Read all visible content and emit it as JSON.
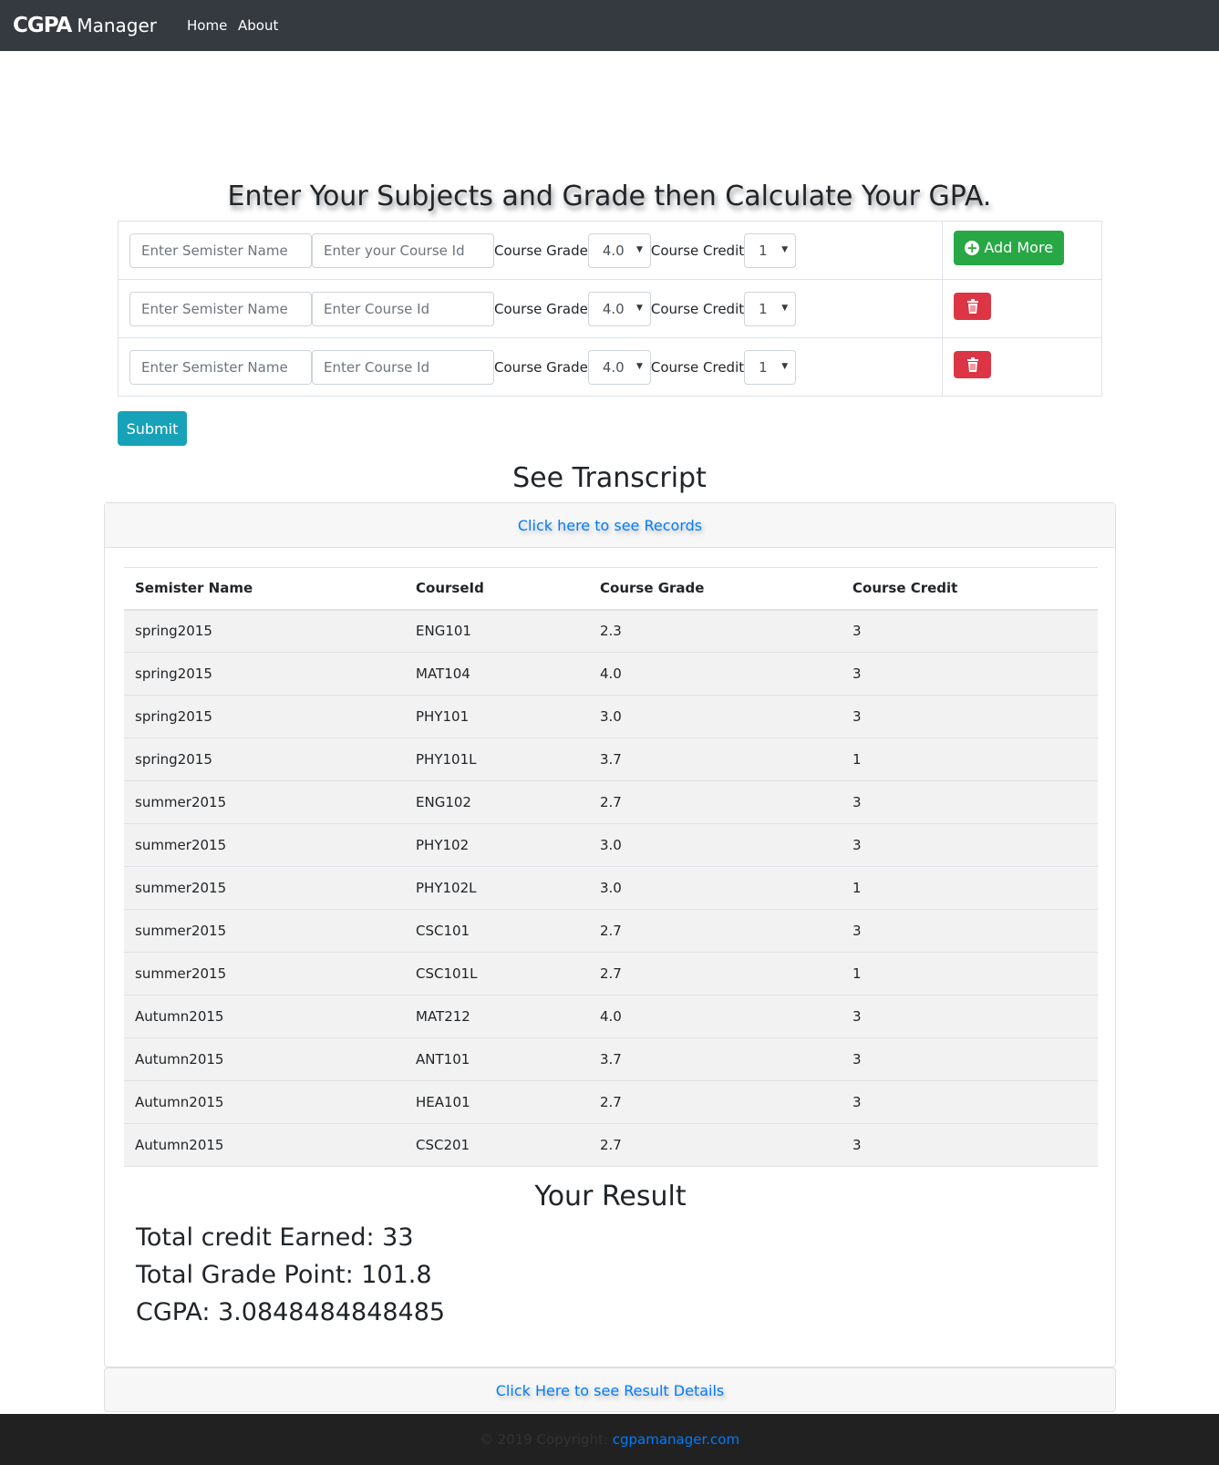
{
  "navbar": {
    "logo_text": "CGPA",
    "brand_text": "Manager",
    "links": [
      {
        "label": "Home"
      },
      {
        "label": "About"
      }
    ]
  },
  "form": {
    "title": "Enter Your Subjects and Grade then Calculate Your GPA.",
    "course_grade_label": "Course Grade",
    "course_credit_label": "Course Credit",
    "add_more_label": "Add More",
    "rows": [
      {
        "semester_placeholder": "Enter Semister Name",
        "course_placeholder": "Enter your Course Id",
        "grade": "4.0",
        "credit": "1"
      },
      {
        "semester_placeholder": "Enter Semister Name",
        "course_placeholder": "Enter Course Id",
        "grade": "4.0",
        "credit": "1"
      },
      {
        "semester_placeholder": "Enter Semister Name",
        "course_placeholder": "Enter Course Id",
        "grade": "4.0",
        "credit": "1"
      }
    ],
    "submit_label": "Submit"
  },
  "transcript": {
    "title": "See Transcript",
    "header_link": "Click here to see Records",
    "columns": [
      "Semister Name",
      "CourseId",
      "Course Grade",
      "Course Credit"
    ],
    "rows": [
      [
        "spring2015",
        "ENG101",
        "2.3",
        "3"
      ],
      [
        "spring2015",
        "MAT104",
        "4.0",
        "3"
      ],
      [
        "spring2015",
        "PHY101",
        "3.0",
        "3"
      ],
      [
        "spring2015",
        "PHY101L",
        "3.7",
        "1"
      ],
      [
        "summer2015",
        "ENG102",
        "2.7",
        "3"
      ],
      [
        "summer2015",
        "PHY102",
        "3.0",
        "3"
      ],
      [
        "summer2015",
        "PHY102L",
        "3.0",
        "1"
      ],
      [
        "summer2015",
        "CSC101",
        "2.7",
        "3"
      ],
      [
        "summer2015",
        "CSC101L",
        "2.7",
        "1"
      ],
      [
        "Autumn2015",
        "MAT212",
        "4.0",
        "3"
      ],
      [
        "Autumn2015",
        "ANT101",
        "3.7",
        "3"
      ],
      [
        "Autumn2015",
        "HEA101",
        "2.7",
        "3"
      ],
      [
        "Autumn2015",
        "CSC201",
        "2.7",
        "3"
      ]
    ],
    "footer_link": "Click Here to see Result Details"
  },
  "result": {
    "title": "Your Result",
    "total_credit": "Total credit Earned: 33",
    "total_grade_point": "Total Grade Point: 101.8",
    "cgpa": "CGPA: 3.0848484848485"
  },
  "footer": {
    "copyright": "© 2019 Copyright:",
    "link": "cgpamanager.com"
  },
  "colors": {
    "navbar_bg": "#343a40",
    "add_button": "#28a745",
    "delete_button": "#dc3545",
    "submit_button": "#17a2b8",
    "link": "#007bff",
    "footer_bg": "#212121"
  }
}
